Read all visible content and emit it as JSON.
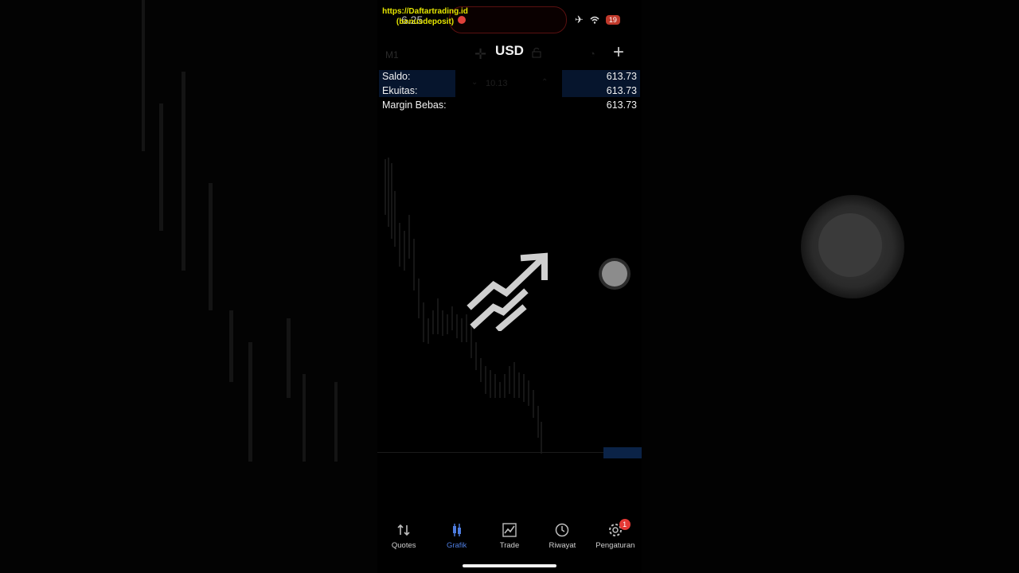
{
  "watermark": {
    "line1": "https://Daftartrading.id",
    "line2": "(bonusdeposit)"
  },
  "statusbar": {
    "time": "6.25",
    "battery": "19"
  },
  "toolbar": {
    "timeframe": "M1",
    "symbol": "USD"
  },
  "account": {
    "rows": [
      {
        "label": "Saldo:",
        "value": "613.73"
      },
      {
        "label": "Ekuitas:",
        "value": "613.73"
      },
      {
        "label": "Margin Bebas:",
        "value": "613.73"
      }
    ],
    "lot_size": "10.13"
  },
  "nav": {
    "items": [
      {
        "label": "Quotes",
        "icon": "arrows-up-down-icon"
      },
      {
        "label": "Grafik",
        "icon": "candlestick-icon",
        "active": true
      },
      {
        "label": "Trade",
        "icon": "line-chart-icon"
      },
      {
        "label": "Riwayat",
        "icon": "history-icon"
      },
      {
        "label": "Pengaturan",
        "icon": "gear-icon",
        "badge": "1"
      }
    ]
  },
  "colors": {
    "accent": "#4e7de0",
    "badge": "#e53935",
    "record": "#e0413a",
    "watermark": "#e6e600"
  }
}
